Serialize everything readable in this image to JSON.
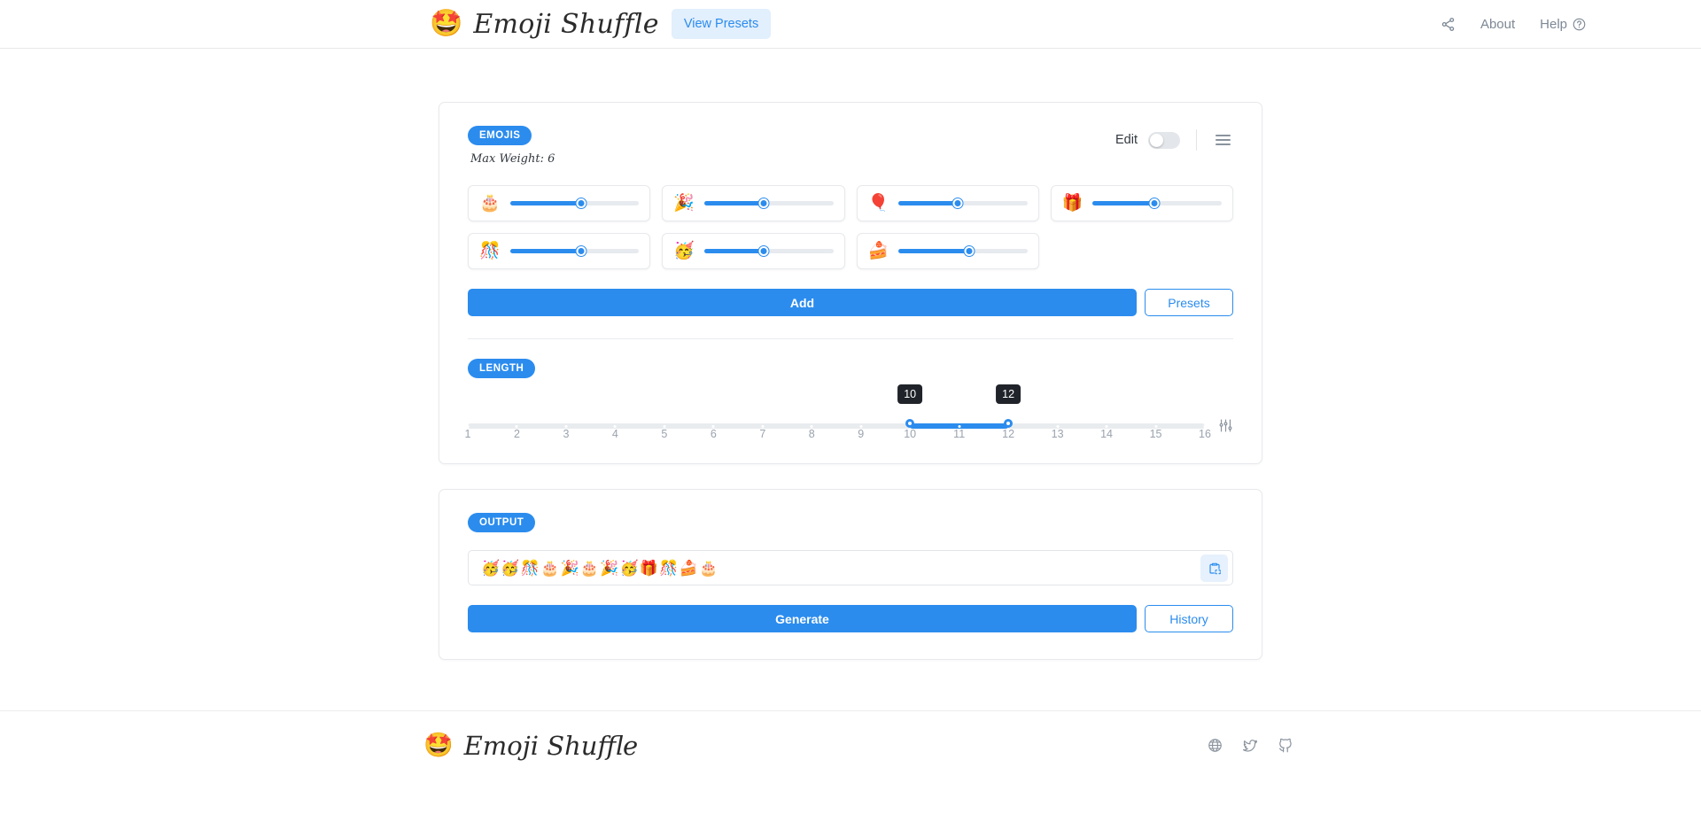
{
  "header": {
    "logo_emoji": "🤩",
    "brand": "Emoji Shuffle",
    "view_presets_label": "View Presets",
    "share_icon": "share-icon",
    "about_label": "About",
    "help_label": "Help",
    "help_icon": "question-circle-icon"
  },
  "emojis_card": {
    "badge": "EMOJIS",
    "max_weight": "Max Weight: 6",
    "edit_label": "Edit",
    "edit_toggle_state": "off",
    "menu_icon": "hamburger-menu-icon",
    "items": [
      {
        "emoji": "🎂",
        "name": "birthday-cake",
        "weight_pct": 55
      },
      {
        "emoji": "🎉",
        "name": "party-popper",
        "weight_pct": 46
      },
      {
        "emoji": "🎈",
        "name": "balloon",
        "weight_pct": 46
      },
      {
        "emoji": "🎁",
        "name": "wrapped-gift",
        "weight_pct": 48
      },
      {
        "emoji": "🎊",
        "name": "confetti-ball",
        "weight_pct": 55
      },
      {
        "emoji": "🥳",
        "name": "partying-face",
        "weight_pct": 46
      },
      {
        "emoji": "🍰",
        "name": "shortcake",
        "weight_pct": 55
      }
    ],
    "add_label": "Add",
    "presets_label": "Presets"
  },
  "length_card": {
    "badge": "LENGTH",
    "min_value": 10,
    "max_value": 12,
    "tick_labels": [
      "1",
      "2",
      "3",
      "4",
      "5",
      "6",
      "7",
      "8",
      "9",
      "10",
      "11",
      "12",
      "13",
      "14",
      "15",
      "16"
    ],
    "range_min": 1,
    "range_max": 16,
    "settings_icon": "sliders-icon"
  },
  "output_card": {
    "badge": "OUTPUT",
    "value": "🥳🥳🎊🎂🎉🎂🎉🥳🎁🎊🍰🎂",
    "copy_icon": "clipboard-copy-icon",
    "generate_label": "Generate",
    "history_label": "History"
  },
  "footer": {
    "logo_emoji": "🤩",
    "brand": "Emoji Shuffle",
    "icons": [
      "globe-www-icon",
      "twitter-icon",
      "github-icon"
    ]
  },
  "colors": {
    "accent": "#2b8cee",
    "accent_soft": "#e2effc",
    "tooltip_bg": "#20242a",
    "track": "#e9ecef",
    "muted_text": "#9aa3ae"
  }
}
